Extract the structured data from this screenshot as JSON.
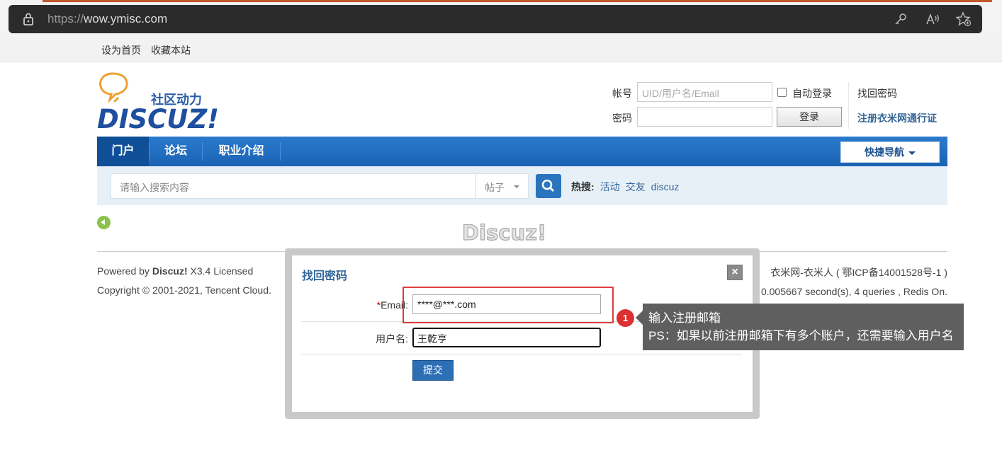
{
  "browser": {
    "url_protocol": "https://",
    "url_host": "wow.ymisc.com"
  },
  "toplinks": {
    "set_home": "设为首页",
    "bookmark": "收藏本站"
  },
  "logo": {
    "tagline": "社区动力",
    "brand": "DISCUZ!"
  },
  "login": {
    "account_label": "帐号",
    "account_placeholder": "UID/用户名/Email",
    "auto_login_label": "自动登录",
    "forgot_password": "找回密码",
    "password_label": "密码",
    "login_button": "登录",
    "register_link": "注册衣米网通行证"
  },
  "nav": {
    "items": [
      "门户",
      "论坛",
      "职业介绍"
    ],
    "quick_nav": "快捷导航"
  },
  "search": {
    "placeholder": "请输入搜索内容",
    "type": "帖子",
    "hot_label": "热搜:",
    "hot_terms": [
      "活动",
      "交友",
      "discuz"
    ]
  },
  "watermark": "Discuz!",
  "footer": {
    "powered_prefix": "Powered by ",
    "powered_brand": "Discuz!",
    "powered_suffix": " X3.4 Licensed",
    "copyright": "Copyright © 2001-2021, Tencent Cloud.",
    "site_right": "衣米网-衣米人 ( 鄂ICP备14001528号-1 )",
    "stats": "0.005667 second(s), 4 queries , Redis On."
  },
  "modal": {
    "title": "找回密码",
    "close": "×",
    "email_required_mark": "*",
    "email_label": "Email:",
    "email_value": "****@***.com",
    "username_label": "用户名:",
    "username_value": "王乾亨",
    "submit_label": "提交"
  },
  "tooltip": {
    "step_number": "1",
    "line1": "输入注册邮箱",
    "line2": "PS：如果以前注册邮箱下有多个账户，还需要输入用户名"
  },
  "colors": {
    "nav_blue": "#1a63b4",
    "link_blue": "#336699",
    "highlight_red": "#e03c3c",
    "tooltip_bg": "#5f5f5f"
  }
}
